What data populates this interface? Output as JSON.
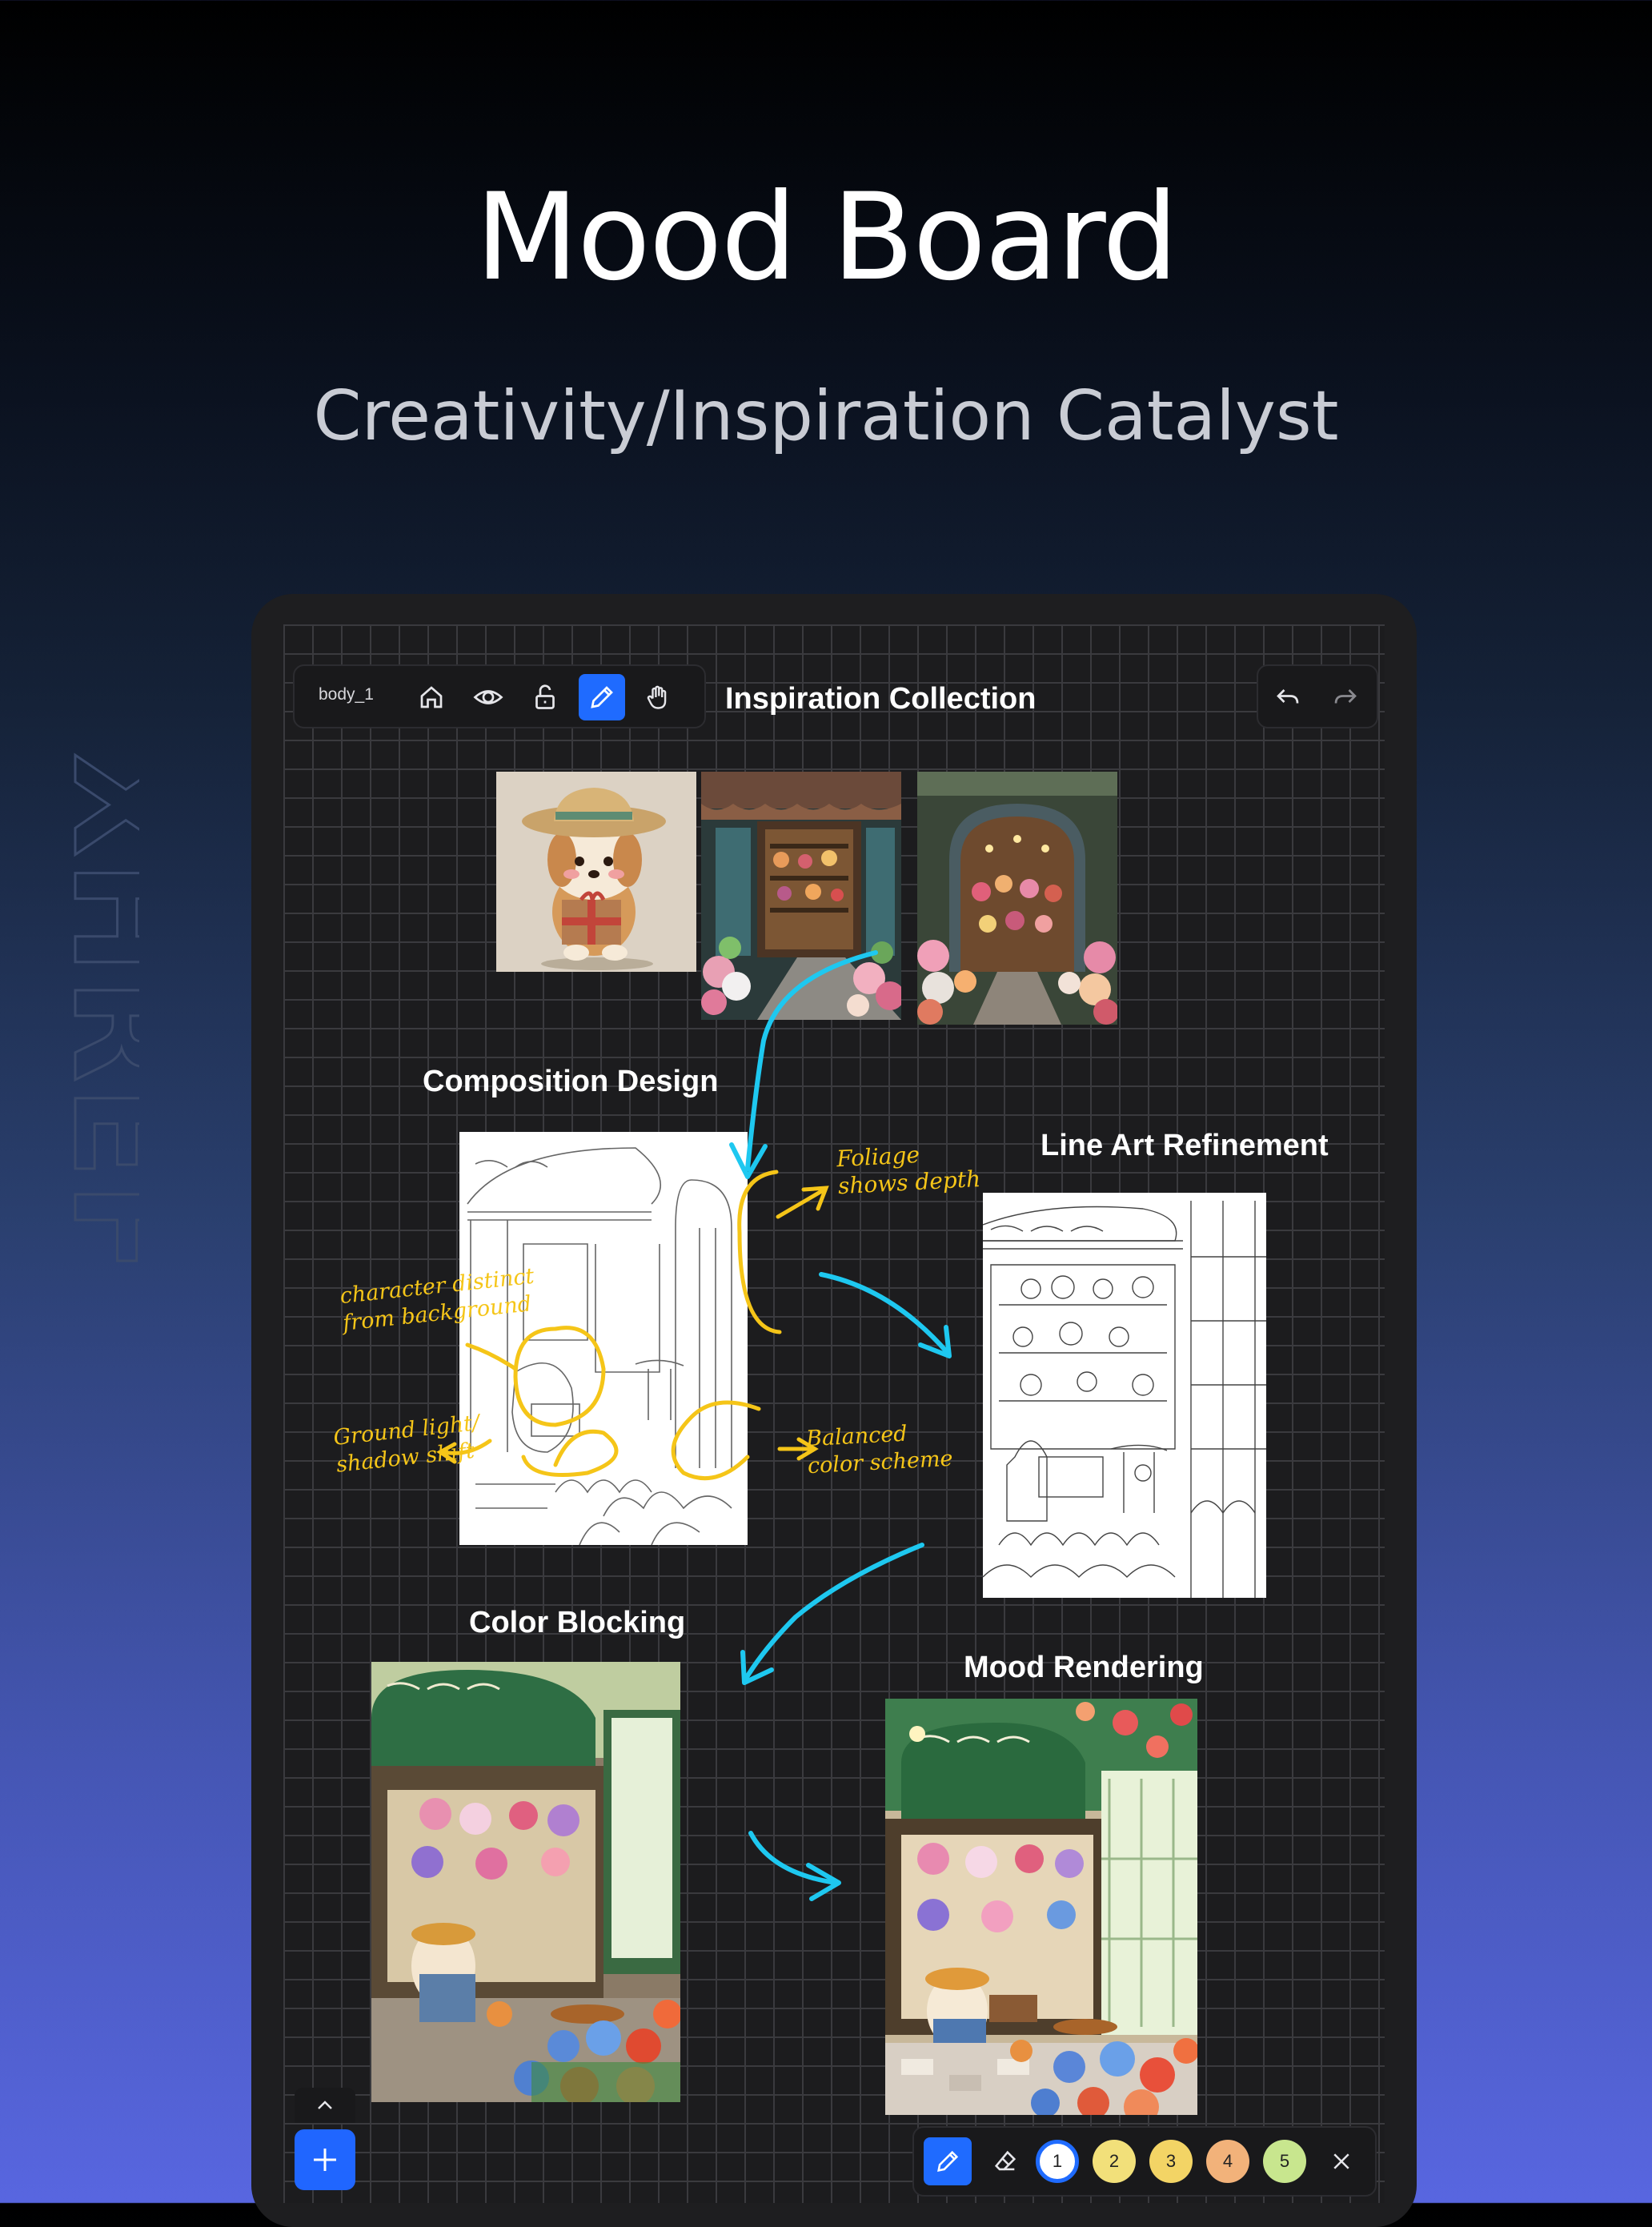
{
  "hero": {
    "title": "Mood Board",
    "subtitle": "Creativity/Inspiration Catalyst",
    "watermark": "XHREF"
  },
  "toolbar": {
    "layer_name": "body_1",
    "tools": [
      "home-icon",
      "eye-icon",
      "unlock-icon",
      "pencil-icon",
      "hand-icon"
    ],
    "active_tool": "pencil-icon"
  },
  "history": {
    "undo_icon": "undo-icon",
    "redo_icon": "redo-icon"
  },
  "canvas": {
    "sections": {
      "inspiration": "Inspiration Collection",
      "composition": "Composition Design",
      "line_art": "Line Art Refinement",
      "color_blocking": "Color Blocking",
      "mood_rendering": "Mood Rendering"
    },
    "annotations": {
      "foliage": "Foliage shows depth",
      "character": "character distinct from background",
      "ground": "Ground light/ shadow shift",
      "balanced": "Balanced color scheme"
    },
    "arrow_color": "#1ec8f0",
    "annotation_color": "#f5c518"
  },
  "pen_bar": {
    "tools": [
      "pen-icon",
      "eraser-icon"
    ],
    "swatches": [
      {
        "label": "1",
        "color": "#ffffff"
      },
      {
        "label": "2",
        "color": "#f2e07a"
      },
      {
        "label": "3",
        "color": "#f3d465"
      },
      {
        "label": "4",
        "color": "#f2b27a"
      },
      {
        "label": "5",
        "color": "#c8e68e"
      }
    ],
    "close_icon": "close-icon"
  },
  "controls": {
    "add_icon": "plus-icon",
    "expand_icon": "chevron-up-icon"
  },
  "colors": {
    "accent": "#1f6bff",
    "canvas": "#1c1c1e",
    "grid": "#3a3a3e"
  }
}
